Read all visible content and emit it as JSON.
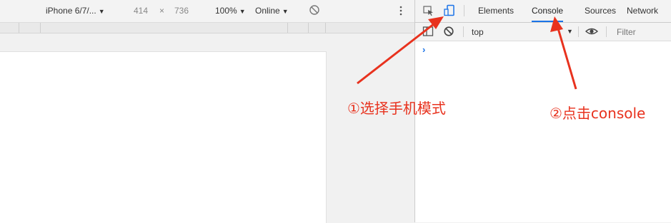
{
  "device_toolbar": {
    "device": "iPhone 6/7/...",
    "width": "414",
    "times": "×",
    "height": "736",
    "zoom": "100%",
    "network": "Online",
    "caret": "▼"
  },
  "devtools": {
    "tabs": [
      {
        "label": "Elements",
        "active": false
      },
      {
        "label": "Console",
        "active": true
      },
      {
        "label": "Sources",
        "active": false
      },
      {
        "label": "Network",
        "active": false
      }
    ],
    "console_toolbar": {
      "context": "top",
      "filter_placeholder": "Filter"
    },
    "prompt": "›"
  },
  "annotations": {
    "step1": "①选择手机模式",
    "step2": "②点击console",
    "color": "#e8321e"
  }
}
